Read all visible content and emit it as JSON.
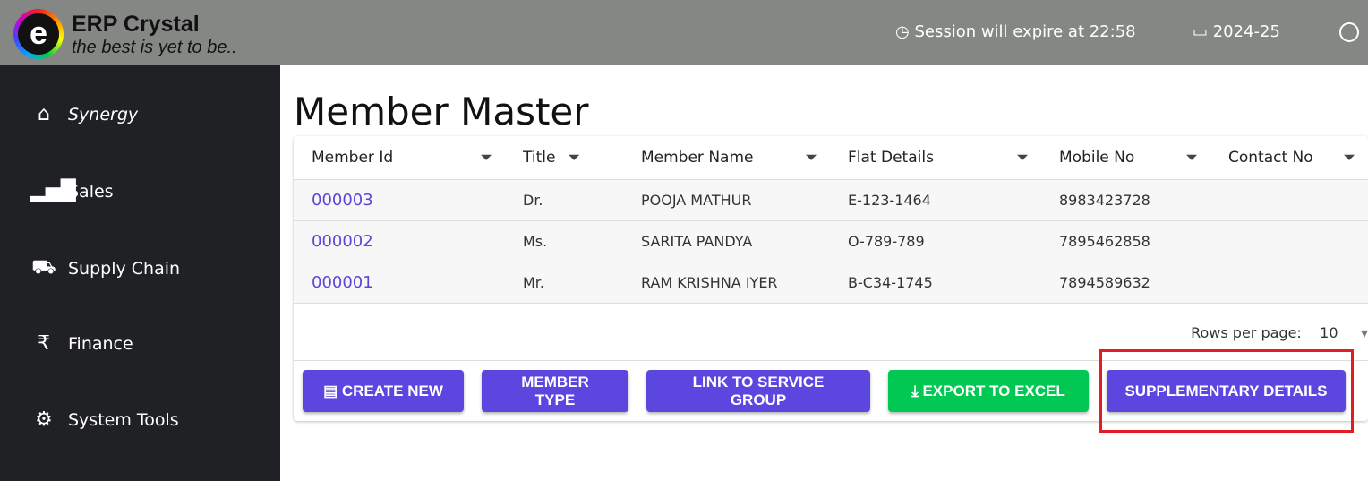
{
  "header": {
    "app_name": "ERP Crystal",
    "tagline": "the best is yet to be..",
    "session": "Session will expire at 22:58",
    "year": "2024-25"
  },
  "sidebar": {
    "items": [
      {
        "label": "Synergy",
        "icon": "home-icon"
      },
      {
        "label": "Sales",
        "icon": "bar-chart-icon"
      },
      {
        "label": "Supply Chain",
        "icon": "truck-icon"
      },
      {
        "label": "Finance",
        "icon": "rupee-icon"
      },
      {
        "label": "System Tools",
        "icon": "gear-icon"
      }
    ]
  },
  "page": {
    "title": "Member Master"
  },
  "table": {
    "columns": [
      "Member Id",
      "Title",
      "Member Name",
      "Flat Details",
      "Mobile No",
      "Contact No"
    ],
    "rows": [
      [
        "000003",
        "Dr.",
        "POOJA MATHUR",
        "E-123-1464",
        "8983423728",
        ""
      ],
      [
        "000002",
        "Ms.",
        "SARITA PANDYA",
        "O-789-789",
        "7895462858",
        ""
      ],
      [
        "000001",
        "Mr.",
        "RAM KRISHNA IYER",
        "B-C34-1745",
        "7894589632",
        ""
      ]
    ]
  },
  "pagination": {
    "label": "Rows per page:",
    "value": "10"
  },
  "buttons": {
    "create": "CREATE NEW",
    "type": "MEMBER TYPE",
    "link": "LINK TO SERVICE GROUP",
    "export": "EXPORT TO EXCEL",
    "supp": "SUPPLEMENTARY DETAILS"
  }
}
